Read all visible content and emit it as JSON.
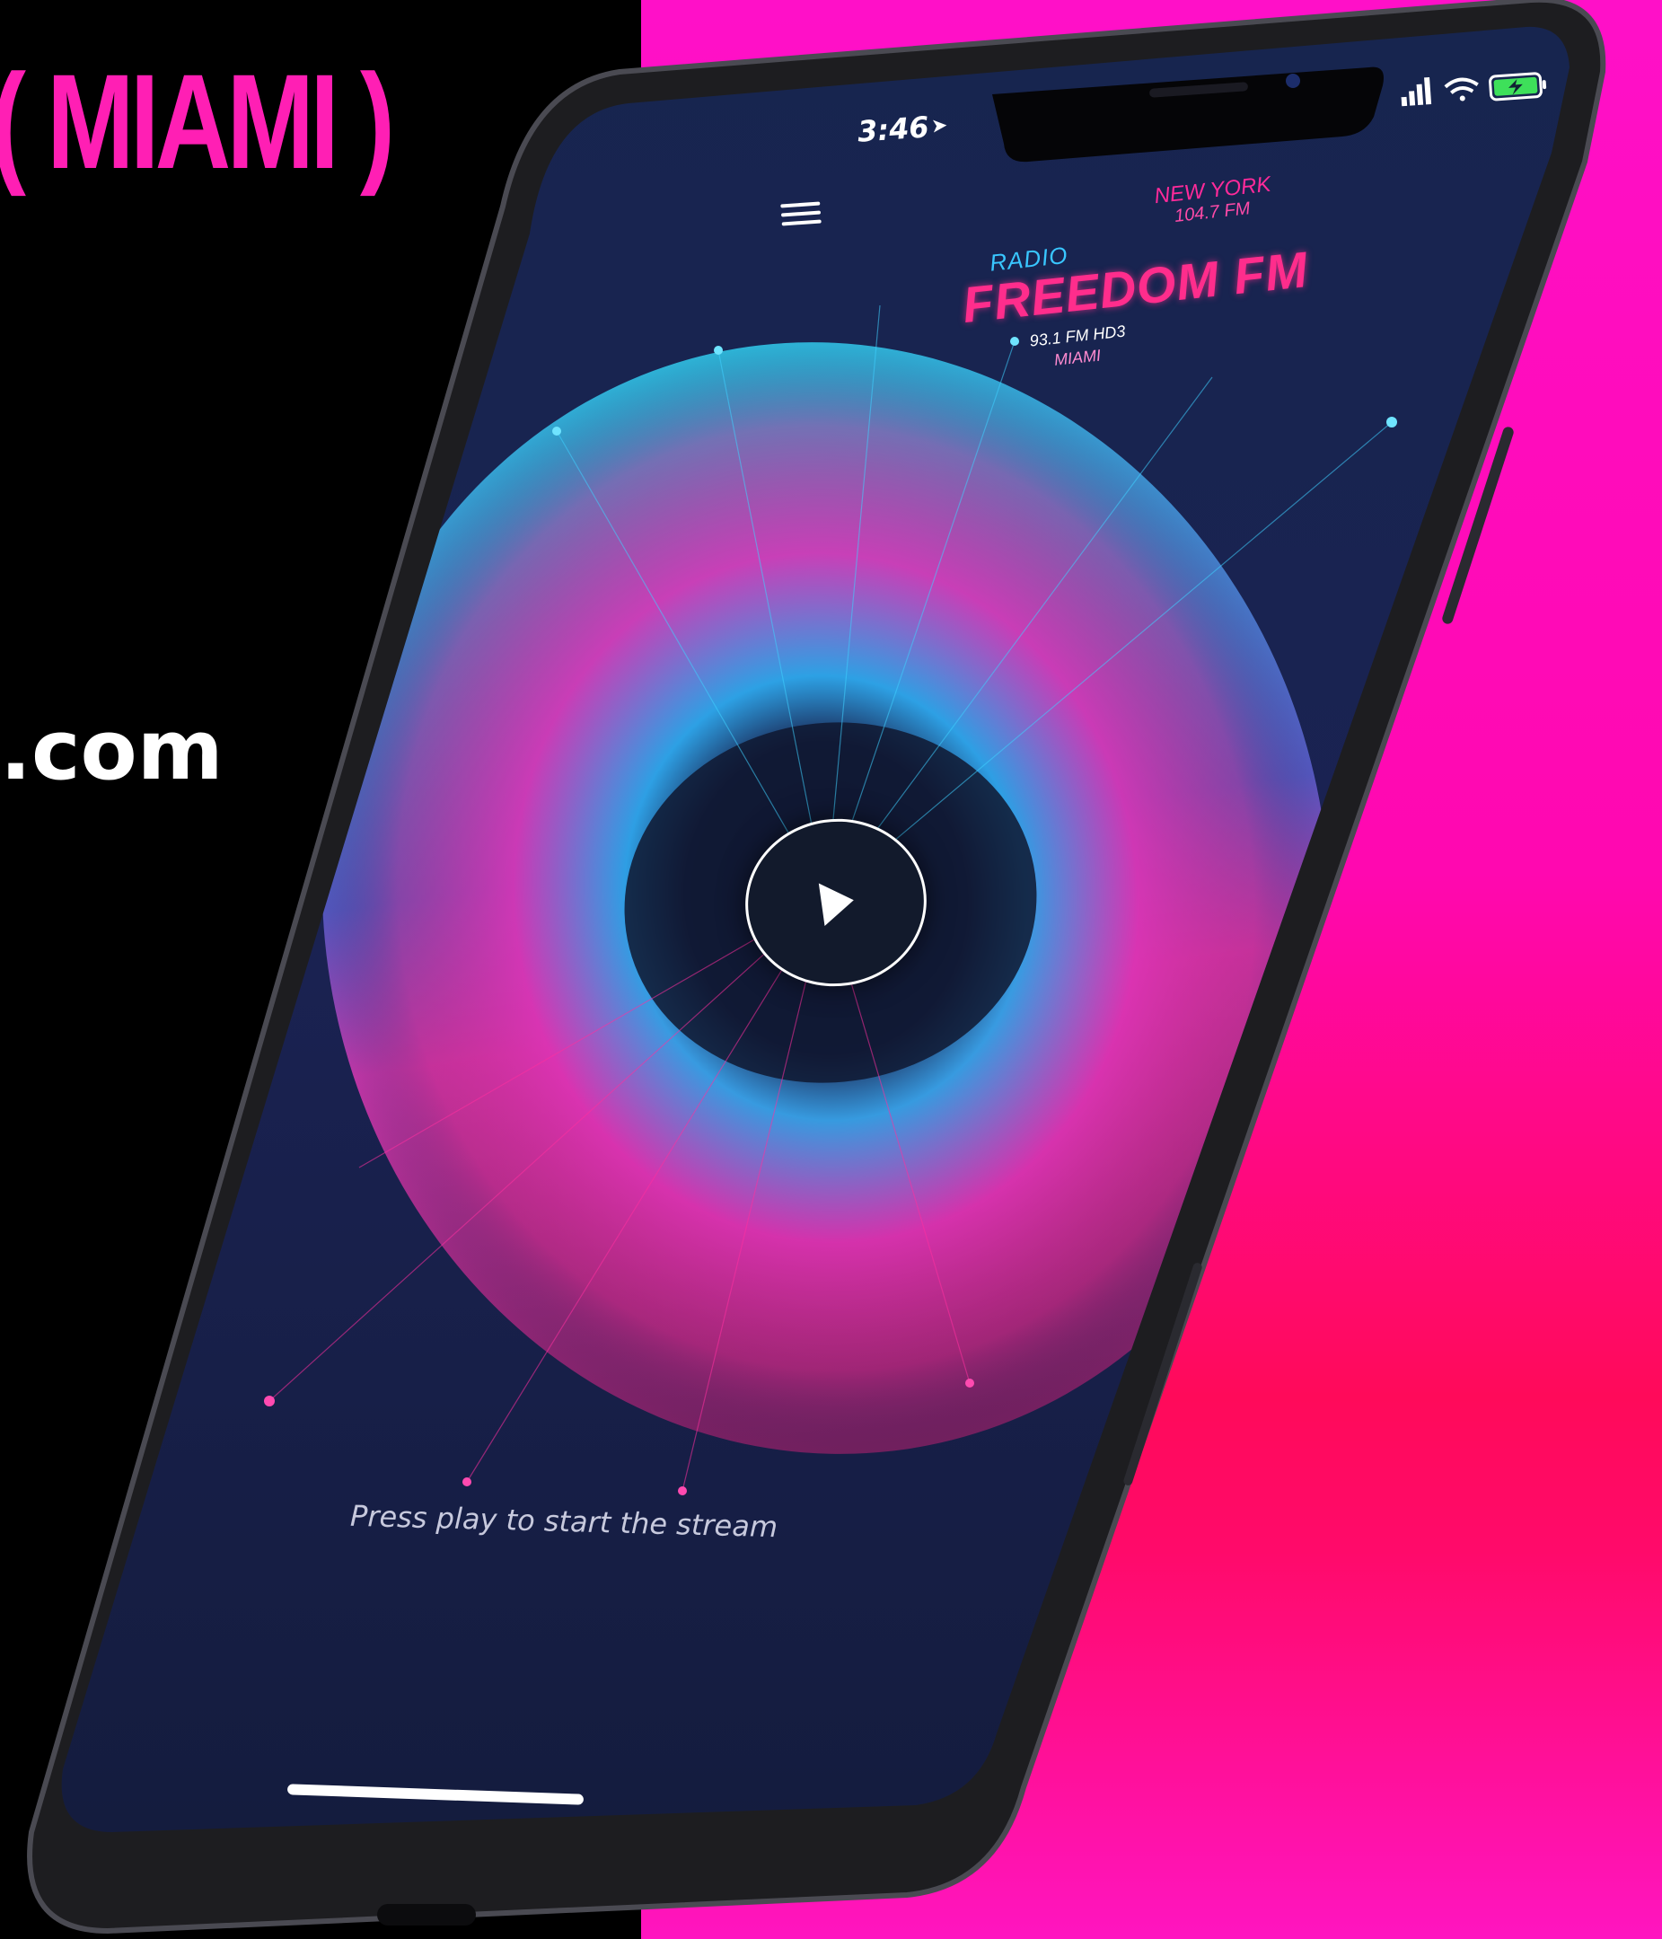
{
  "promo": {
    "headline": "( MIAMI )",
    "domain": ".com"
  },
  "status_bar": {
    "time": "3:46",
    "location_icon": "location-arrow-icon",
    "signal_icon": "cellular-signal-icon",
    "wifi_icon": "wifi-icon",
    "battery_icon": "battery-charging-icon"
  },
  "app": {
    "menu_icon": "hamburger-menu-icon",
    "logo": {
      "top_city": "NEW YORK",
      "top_frequency": "104.7 FM",
      "prefix": "RADIO",
      "name": "FREEDOM FM",
      "bottom_frequency": "93.1 FM HD3",
      "bottom_city": "MIAMI"
    },
    "play_icon": "play-icon",
    "hint": "Press play to start the stream"
  },
  "colors": {
    "background_right": "#ff10c8",
    "background_left": "#000000",
    "accent_pink": "#ff2d8c",
    "accent_cyan": "#39c6ff",
    "screen_bg": "#16224a"
  }
}
